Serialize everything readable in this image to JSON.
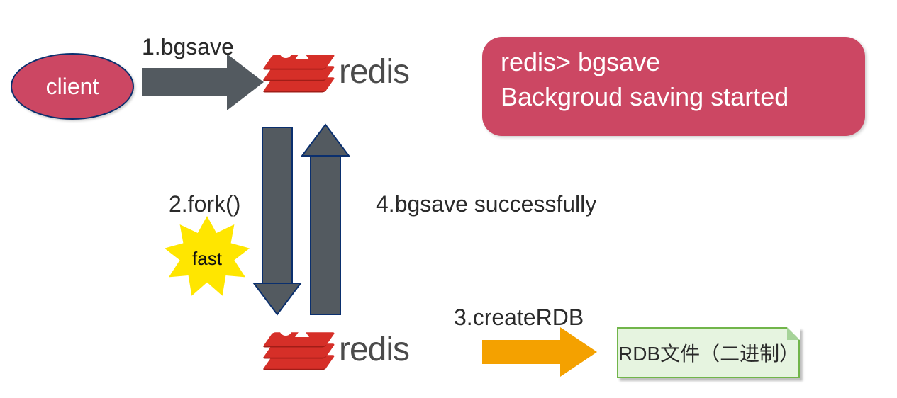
{
  "nodes": {
    "client": "client",
    "redis_word": "redis",
    "fast_badge": "fast",
    "rdb_file": "RDB文件（二进制）"
  },
  "labels": {
    "step1": "1.bgsave",
    "step2": "2.fork()",
    "step3": "3.createRDB",
    "step4": "4.bgsave successfully"
  },
  "command_panel": {
    "line1": "redis> bgsave",
    "line2": "Backgroud saving started"
  },
  "colors": {
    "pink": "#cc4763",
    "gray_arrow": "#535a60",
    "orange_arrow": "#f4a100",
    "navy_stroke": "#0a2f6e",
    "star_yellow": "#ffe600",
    "green_fill": "#e6f4e0",
    "green_border": "#71b54a",
    "redis_red": "#d62f28"
  }
}
